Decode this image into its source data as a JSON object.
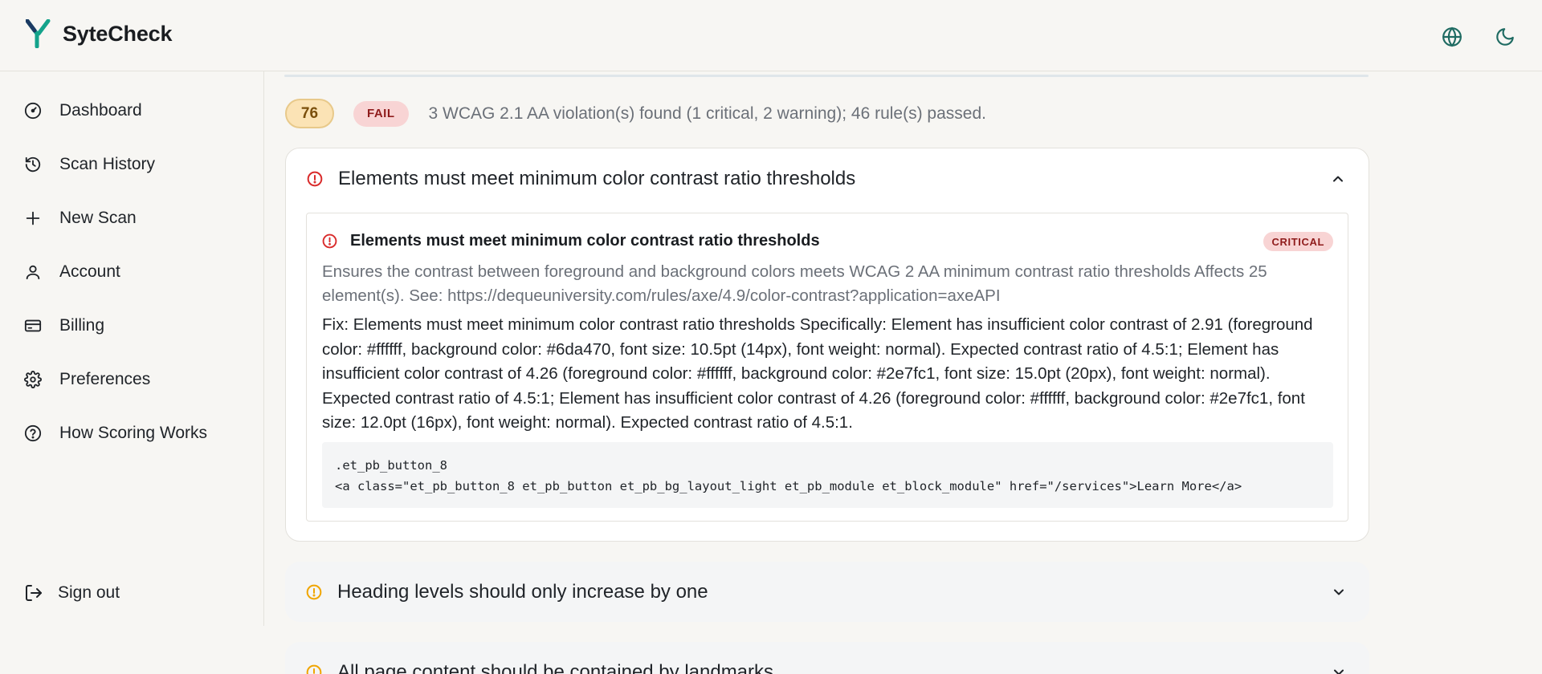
{
  "app": {
    "name": "SyteCheck"
  },
  "header": {
    "icons": [
      "globe-icon",
      "moon-icon"
    ]
  },
  "sidebar": {
    "items": [
      {
        "label": "Dashboard",
        "icon": "dashboard-icon"
      },
      {
        "label": "Scan History",
        "icon": "history-icon"
      },
      {
        "label": "New Scan",
        "icon": "plus-icon"
      },
      {
        "label": "Account",
        "icon": "user-icon"
      },
      {
        "label": "Billing",
        "icon": "credit-card-icon"
      },
      {
        "label": "Preferences",
        "icon": "gear-icon"
      },
      {
        "label": "How Scoring Works",
        "icon": "help-circle-icon"
      }
    ],
    "signout": {
      "label": "Sign out",
      "icon": "logout-icon"
    }
  },
  "summary": {
    "score": "76",
    "status": "FAIL",
    "text": "3 WCAG 2.1 AA violation(s) found (1 critical, 2 warning); 46 rule(s) passed."
  },
  "violations": [
    {
      "title": "Elements must meet minimum color contrast ratio thresholds",
      "severity_icon": "alert-circle-icon",
      "expanded": true,
      "detail": {
        "title": "Elements must meet minimum color contrast ratio thresholds",
        "badge": "CRITICAL",
        "description": "Ensures the contrast between foreground and background colors meets WCAG 2 AA minimum contrast ratio thresholds Affects 25 element(s). See: https://dequeuniversity.com/rules/axe/4.9/color-contrast?application=axeAPI",
        "fix": "Fix: Elements must meet minimum color contrast ratio thresholds Specifically: Element has insufficient color contrast of 2.91 (foreground color: #ffffff, background color: #6da470, font size: 10.5pt (14px), font weight: normal). Expected contrast ratio of 4.5:1; Element has insufficient color contrast of 4.26 (foreground color: #ffffff, background color: #2e7fc1, font size: 15.0pt (20px), font weight: normal). Expected contrast ratio of 4.5:1; Element has insufficient color contrast of 4.26 (foreground color: #ffffff, background color: #2e7fc1, font size: 12.0pt (16px), font weight: normal). Expected contrast ratio of 4.5:1.",
        "code_selector": ".et_pb_button_8",
        "code_html": "<a class=\"et_pb_button_8 et_pb_button et_pb_bg_layout_light et_pb_module et_block_module\" href=\"/services\">Learn More</a>"
      }
    },
    {
      "title": "Heading levels should only increase by one",
      "severity_icon": "alert-circle-icon",
      "expanded": false
    },
    {
      "title": "All page content should be contained by landmarks",
      "severity_icon": "alert-circle-icon",
      "expanded": false
    }
  ],
  "colors": {
    "brand": "#14a38b",
    "critical": "#d92b2b",
    "warning": "#f0a500",
    "score_bg": "#fbe3b5",
    "fail_bg": "#f8d4d4"
  }
}
